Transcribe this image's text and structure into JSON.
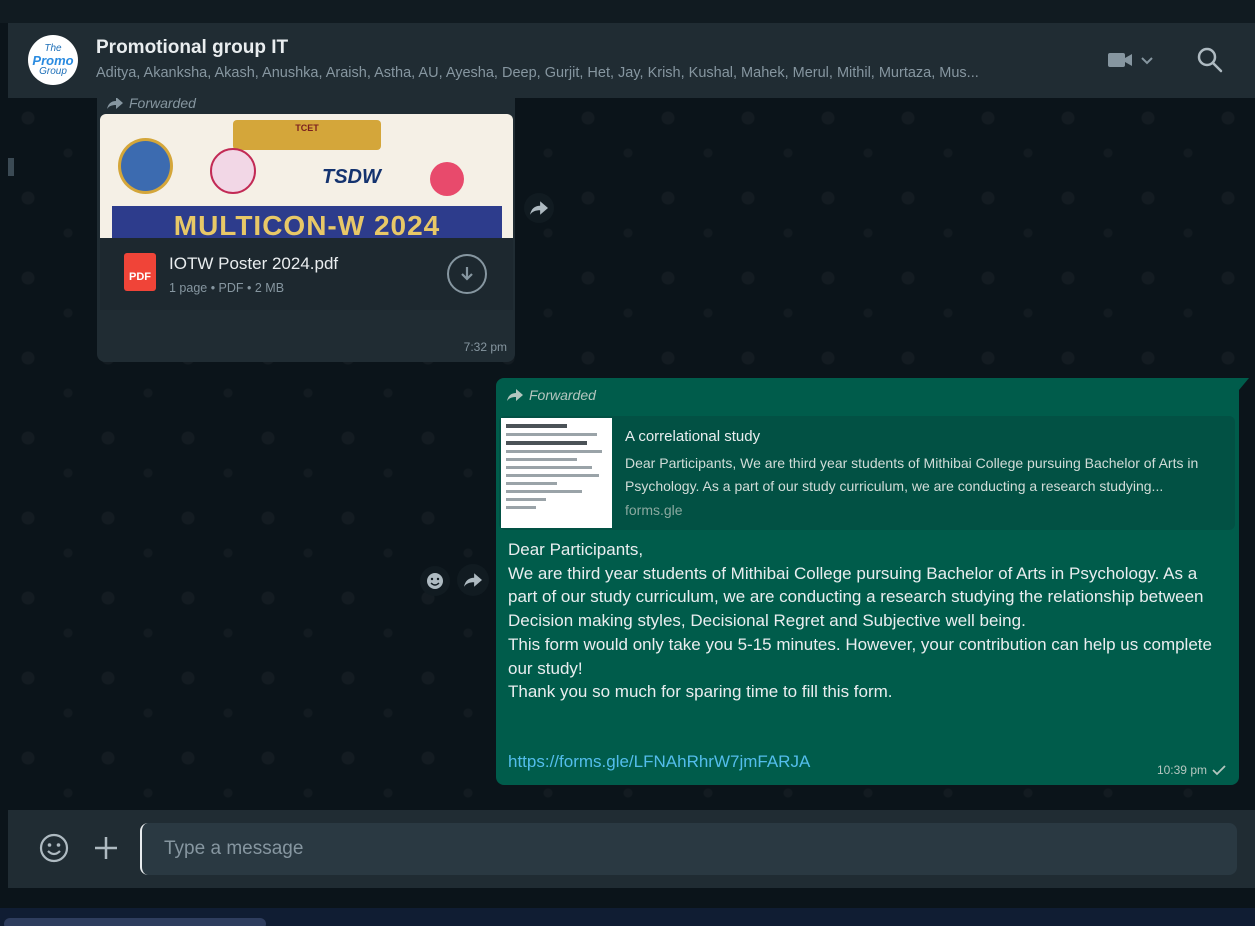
{
  "header": {
    "avatar_line1": "The",
    "avatar_line2": "Promo",
    "avatar_line3": "Group",
    "title": "Promotional group IT",
    "members": "Aditya, Akanksha, Akash, Anushka, Araish, Astha, AU, Ayesha, Deep, Gurjit, Het, Jay, Krish, Kushal, Mahek, Merul, Mithil, Murtaza, Mus...",
    "video_icon": "video-camera-icon",
    "search_icon": "search-icon"
  },
  "messages": {
    "incoming": {
      "forwarded_label": "Forwarded",
      "poster": {
        "ribbon_text": "TCET",
        "logo_text": "TSDW",
        "banner_text": "MULTICON-W 2024"
      },
      "document": {
        "icon_label": "PDF",
        "file_name": "IOTW Poster 2024.pdf",
        "meta": "1 page • PDF • 2 MB"
      },
      "time": "7:32 pm"
    },
    "outgoing": {
      "forwarded_label": "Forwarded",
      "link_preview": {
        "title": "A correlational study",
        "description": "Dear Participants, We are third year students of Mithibai College pursuing Bachelor of Arts in Psychology. As a part of our study curriculum, we are conducting a research studying...",
        "domain": "forms.gle"
      },
      "text_lines": [
        "Dear Participants,",
        "We are third year students of Mithibai College pursuing Bachelor of Arts in Psychology. As a part of our study curriculum, we are conducting a research studying the relationship between Decision making styles, Decisional Regret and Subjective well being.",
        "This form would only take you 5-15 minutes. However, your contribution can help us complete our study!",
        "Thank you so much for sparing time to fill this form."
      ],
      "link": "https://forms.gle/LFNAhRhrW7jmFARJA",
      "time": "10:39 pm",
      "status_icon": "single-check-icon"
    }
  },
  "composer": {
    "placeholder": "Type a message",
    "emoji_icon": "emoji-icon",
    "attach_icon": "plus-icon"
  },
  "colors": {
    "header_bg": "#202c33",
    "chat_bg": "#0b141a",
    "incoming_bubble": "#202c33",
    "outgoing_bubble": "#005c4b",
    "link_color": "#53bdeb"
  }
}
